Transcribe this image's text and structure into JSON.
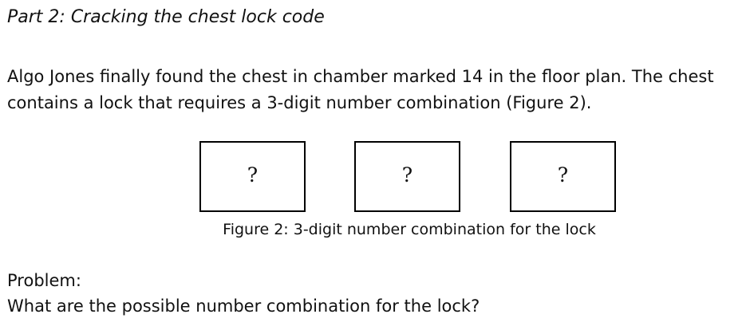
{
  "part_title": "Part 2: Cracking the chest lock code",
  "intro": "Algo Jones finally found the chest in chamber marked 14 in the floor plan. The chest contains a lock that requires a 3-digit number combination (Figure 2).",
  "lock": {
    "digits": [
      "?",
      "?",
      "?"
    ],
    "caption": "Figure 2: 3-digit number combination for the lock"
  },
  "problem": {
    "label": "Problem:",
    "question": "What are the possible number combination for the lock?"
  }
}
